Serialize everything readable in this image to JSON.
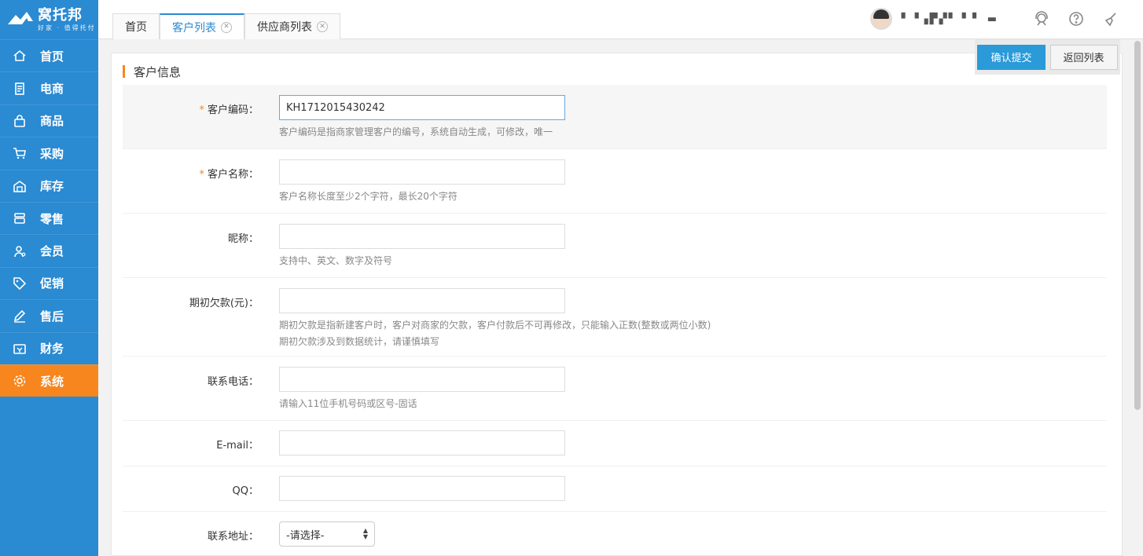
{
  "brand": {
    "title": "窝托邦",
    "subtitle": "好家 · 值得托付"
  },
  "sidebar": {
    "items": [
      {
        "label": "首页",
        "icon": "home-icon"
      },
      {
        "label": "电商",
        "icon": "document-icon"
      },
      {
        "label": "商品",
        "icon": "bag-icon"
      },
      {
        "label": "采购",
        "icon": "cart-icon"
      },
      {
        "label": "库存",
        "icon": "warehouse-icon"
      },
      {
        "label": "零售",
        "icon": "store-icon"
      },
      {
        "label": "会员",
        "icon": "member-icon"
      },
      {
        "label": "促销",
        "icon": "tag-icon"
      },
      {
        "label": "售后",
        "icon": "edit-icon"
      },
      {
        "label": "财务",
        "icon": "finance-icon"
      },
      {
        "label": "系统",
        "icon": "gear-icon",
        "active": true
      }
    ]
  },
  "tabs": [
    {
      "label": "首页"
    },
    {
      "label": "客户列表",
      "active": true,
      "closable": true
    },
    {
      "label": "供应商列表",
      "closable": true
    }
  ],
  "header": {
    "username": "▘▝▗▛▞▘▝ ▘ ▬"
  },
  "section": {
    "title": "客户信息"
  },
  "actions": {
    "submit": "确认提交",
    "back": "返回列表"
  },
  "form": {
    "code": {
      "label": "客户编码：",
      "required": true,
      "value": "KH1712015430242",
      "hint": "客户编码是指商家管理客户的编号，系统自动生成，可修改，唯一"
    },
    "name": {
      "label": "客户名称：",
      "required": true,
      "value": "",
      "hint": "客户名称长度至少2个字符，最长20个字符"
    },
    "nickname": {
      "label": "昵称：",
      "value": "",
      "hint": "支持中、英文、数字及符号"
    },
    "debt": {
      "label": "期初欠款(元)：",
      "value": "",
      "hint1": "期初欠款是指新建客户时，客户对商家的欠款，客户付款后不可再修改，只能输入正数(整数或两位小数)",
      "hint2": "期初欠款涉及到数据统计，请谨慎填写"
    },
    "phone": {
      "label": "联系电话：",
      "value": "",
      "hint": "请输入11位手机号码或区号-固话"
    },
    "email": {
      "label": "E-mail：",
      "value": ""
    },
    "qq": {
      "label": "QQ：",
      "value": ""
    },
    "address": {
      "label": "联系地址：",
      "select": "-请选择-"
    }
  },
  "colors": {
    "sidebar": "#2a8ad2",
    "active": "#f7861e",
    "primary": "#2a9ad8"
  }
}
